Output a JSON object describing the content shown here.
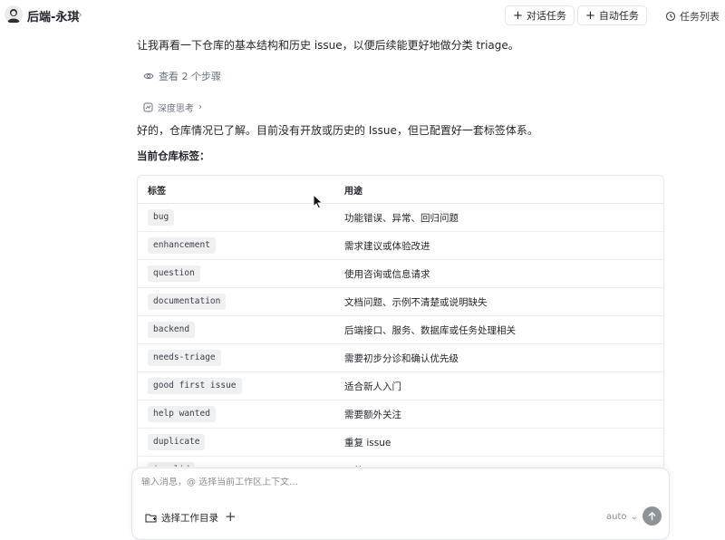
{
  "header": {
    "agent_name": "后端-永琪",
    "buttons": {
      "chat_task": "对话任务",
      "auto_task": "自动任务",
      "task_list": "任务列表"
    }
  },
  "messages": {
    "line1": "让我再看一下仓库的基本结构和历史 issue，以便后续能更好地做分类 triage。",
    "steps_label": "查看 2 个步骤",
    "thinking_label": "深度思考",
    "line2": "好的，仓库情况已了解。目前没有开放或历史的 Issue，但已配置好一套标签体系。",
    "section_title": "当前仓库标签："
  },
  "table": {
    "headers": [
      "标签",
      "用途"
    ],
    "rows": [
      {
        "tag": "bug",
        "desc": "功能错误、异常、回归问题"
      },
      {
        "tag": "enhancement",
        "desc": "需求建议或体验改进"
      },
      {
        "tag": "question",
        "desc": "使用咨询或信息请求"
      },
      {
        "tag": "documentation",
        "desc": "文档问题、示例不清楚或说明缺失"
      },
      {
        "tag": "backend",
        "desc": "后端接口、服务、数据库或任务处理相关"
      },
      {
        "tag": "needs-triage",
        "desc": "需要初步分诊和确认优先级"
      },
      {
        "tag": "good first issue",
        "desc": "适合新人入门"
      },
      {
        "tag": "help wanted",
        "desc": "需要额外关注"
      },
      {
        "tag": "duplicate",
        "desc": "重复 issue"
      },
      {
        "tag": "invalid",
        "desc": "无效 issue"
      }
    ]
  },
  "composer": {
    "placeholder": "输入消息，@ 选择当前工作区上下文...",
    "value": "",
    "dir_label": "选择工作目录",
    "model": "auto"
  },
  "colors": {
    "accent": "#1f2329",
    "send_button": "#8f9398",
    "tag_bg": "#eef0f2"
  }
}
